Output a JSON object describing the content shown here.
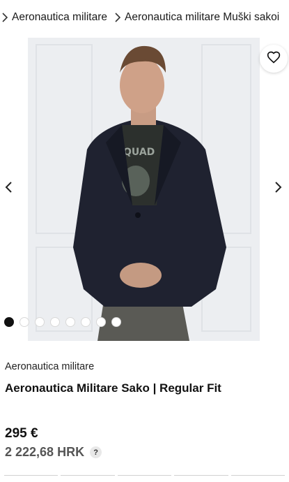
{
  "breadcrumb": {
    "items": [
      {
        "label": "Aeronautica militare"
      },
      {
        "label": "Aeronautica militare Muški sakoi"
      }
    ]
  },
  "gallery": {
    "image_count": 8,
    "active_index": 0,
    "shirt_print": "QUAD",
    "icons": {
      "favorite": "heart-outline-icon",
      "prev": "chevron-left-icon",
      "next": "chevron-right-icon"
    }
  },
  "product": {
    "brand": "Aeronautica militare",
    "title": "Aeronautica Militare Sako | Regular Fit",
    "price": "295 €",
    "price_alt": "2 222,68 HRK",
    "help_label": "?"
  },
  "colors": {
    "text": "#111111",
    "secondary_text": "#555555",
    "dot_active": "#111111",
    "background": "#ffffff"
  }
}
